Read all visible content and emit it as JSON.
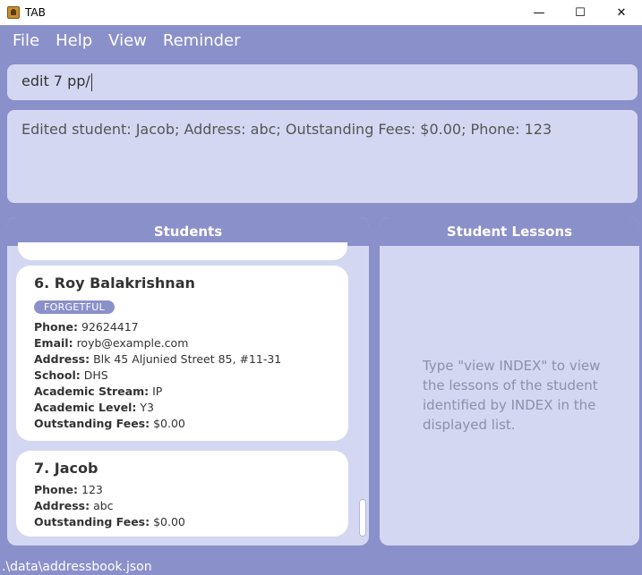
{
  "window": {
    "title": "TAB",
    "minimize": "—",
    "maximize": "☐",
    "close": "✕"
  },
  "menu": [
    "File",
    "Help",
    "View",
    "Reminder"
  ],
  "command_box": {
    "value": "edit 7 pp/"
  },
  "result_box": {
    "text": "Edited student: Jacob; Address: abc; Outstanding Fees: $0.00; Phone: 123"
  },
  "students_panel": {
    "title": "Students",
    "cards": [
      {
        "name": "6.  Roy Balakrishnan",
        "tag": "FORGETFUL",
        "fields": [
          {
            "label": "Phone:",
            "value": "92624417"
          },
          {
            "label": "Email:",
            "value": "royb@example.com"
          },
          {
            "label": "Address:",
            "value": "Blk 45 Aljunied Street 85, #11-31"
          },
          {
            "label": "School:",
            "value": "DHS"
          },
          {
            "label": "Academic Stream:",
            "value": "IP"
          },
          {
            "label": "Academic Level:",
            "value": "Y3"
          },
          {
            "label": "Outstanding Fees:",
            "value": "$0.00"
          }
        ]
      },
      {
        "name": "7.  Jacob",
        "fields": [
          {
            "label": "Phone:",
            "value": "123"
          },
          {
            "label": "Address:",
            "value": "abc"
          },
          {
            "label": "Outstanding Fees:",
            "value": "$0.00"
          }
        ]
      }
    ]
  },
  "lessons_panel": {
    "title": "Student Lessons",
    "empty_message": "Type \"view INDEX\" to view the lessons of the student identified by INDEX in the displayed list."
  },
  "status_bar": {
    "path": ".\\data\\addressbook.json"
  },
  "colors": {
    "accent": "#8a90c9",
    "panel_bg": "#d4d7f1",
    "card_bg": "#ffffff"
  }
}
